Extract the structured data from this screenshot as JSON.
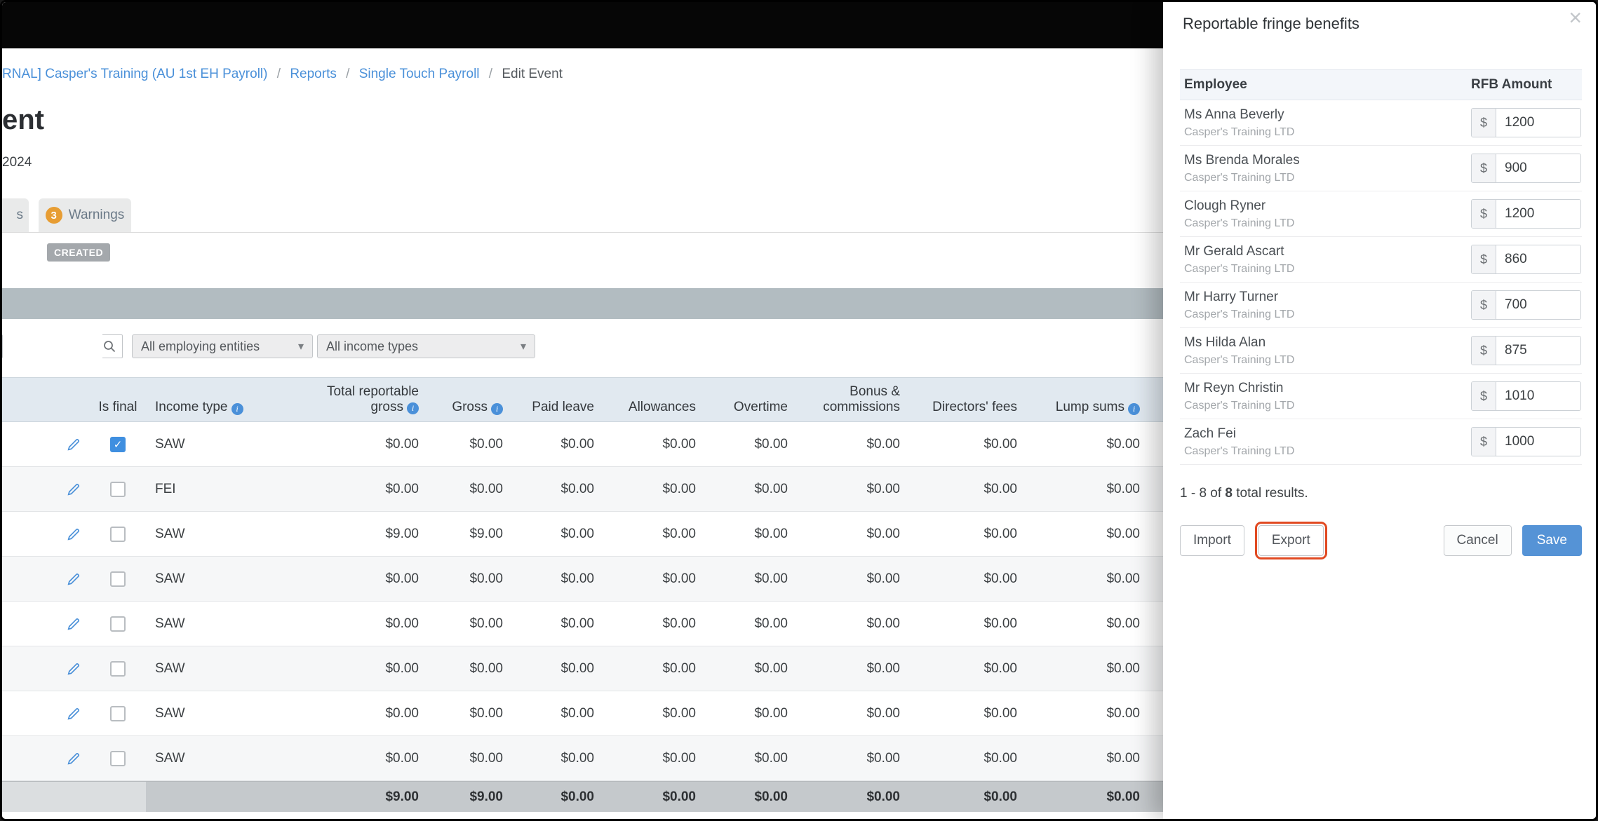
{
  "icons": {
    "check": "✓",
    "caret": "▾",
    "close": "×",
    "info": "i",
    "separator": "/",
    "search": "magnifier",
    "edit": "pencil"
  },
  "colors": {
    "link_blue": "#4a90d9",
    "checkbox_blue": "#3f8fe0",
    "warning_badge_orange": "#e79d33",
    "save_button_blue": "#5593d6",
    "export_highlight_red": "#e14a22"
  },
  "breadcrumb": {
    "items": [
      "RNAL] Casper's Training (AU 1st EH Payroll)",
      "Reports",
      "Single Touch Payroll",
      "Edit Event"
    ]
  },
  "page": {
    "heading_partial": "ent",
    "subheading": "2024",
    "tab_partial": "s",
    "warnings_tab": {
      "count": "3",
      "label": "Warnings"
    },
    "status_badge": "CREATED"
  },
  "filters": {
    "search_value": "",
    "employing_entities": "All employing entities",
    "income_types": "All income types"
  },
  "stp_table": {
    "headers": [
      "Is final",
      "Income type",
      "Total reportable gross",
      "Gross",
      "Paid leave",
      "Allowances",
      "Overtime",
      "Bonus & commissions",
      "Directors' fees",
      "Lump sums"
    ],
    "rows": [
      {
        "is_final": true,
        "income_type": "SAW",
        "values": [
          "$0.00",
          "$0.00",
          "$0.00",
          "$0.00",
          "$0.00",
          "$0.00",
          "$0.00",
          "$0.00"
        ]
      },
      {
        "is_final": false,
        "income_type": "FEI",
        "values": [
          "$0.00",
          "$0.00",
          "$0.00",
          "$0.00",
          "$0.00",
          "$0.00",
          "$0.00",
          "$0.00"
        ]
      },
      {
        "is_final": false,
        "income_type": "SAW",
        "values": [
          "$9.00",
          "$9.00",
          "$0.00",
          "$0.00",
          "$0.00",
          "$0.00",
          "$0.00",
          "$0.00"
        ]
      },
      {
        "is_final": false,
        "income_type": "SAW",
        "values": [
          "$0.00",
          "$0.00",
          "$0.00",
          "$0.00",
          "$0.00",
          "$0.00",
          "$0.00",
          "$0.00"
        ]
      },
      {
        "is_final": false,
        "income_type": "SAW",
        "values": [
          "$0.00",
          "$0.00",
          "$0.00",
          "$0.00",
          "$0.00",
          "$0.00",
          "$0.00",
          "$0.00"
        ]
      },
      {
        "is_final": false,
        "income_type": "SAW",
        "values": [
          "$0.00",
          "$0.00",
          "$0.00",
          "$0.00",
          "$0.00",
          "$0.00",
          "$0.00",
          "$0.00"
        ]
      },
      {
        "is_final": false,
        "income_type": "SAW",
        "values": [
          "$0.00",
          "$0.00",
          "$0.00",
          "$0.00",
          "$0.00",
          "$0.00",
          "$0.00",
          "$0.00"
        ]
      },
      {
        "is_final": false,
        "income_type": "SAW",
        "values": [
          "$0.00",
          "$0.00",
          "$0.00",
          "$0.00",
          "$0.00",
          "$0.00",
          "$0.00",
          "$0.00"
        ]
      }
    ],
    "totals": [
      "$9.00",
      "$9.00",
      "$0.00",
      "$0.00",
      "$0.00",
      "$0.00",
      "$0.00",
      "$0.00"
    ]
  },
  "modal": {
    "title": "Reportable fringe benefits",
    "columns": {
      "employee": "Employee",
      "amount": "RFB Amount"
    },
    "currency": "$",
    "rows": [
      {
        "name": "Ms Anna Beverly",
        "company": "Casper's Training LTD",
        "amount": "1200"
      },
      {
        "name": "Ms Brenda Morales",
        "company": "Casper's Training LTD",
        "amount": "900"
      },
      {
        "name": "Clough Ryner",
        "company": "Casper's Training LTD",
        "amount": "1200"
      },
      {
        "name": "Mr Gerald Ascart",
        "company": "Casper's Training LTD",
        "amount": "860"
      },
      {
        "name": "Mr Harry Turner",
        "company": "Casper's Training LTD",
        "amount": "700"
      },
      {
        "name": "Ms Hilda Alan",
        "company": "Casper's Training LTD",
        "amount": "875"
      },
      {
        "name": "Mr Reyn Christin",
        "company": "Casper's Training LTD",
        "amount": "1010"
      },
      {
        "name": "Zach Fei",
        "company": "Casper's Training LTD",
        "amount": "1000"
      }
    ],
    "results": {
      "prefix": "1 - 8 of ",
      "total": "8",
      "suffix": " total results."
    },
    "buttons": {
      "import": "Import",
      "export": "Export",
      "cancel": "Cancel",
      "save": "Save"
    }
  }
}
